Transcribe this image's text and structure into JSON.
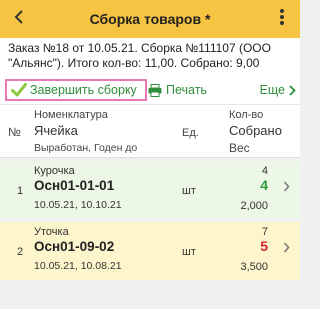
{
  "header": {
    "title": "Сборка товаров *",
    "back_icon": "chevron-left-icon",
    "menu_icon": "more-vertical-icon",
    "bg_color": "#f7c343"
  },
  "order": {
    "line1": "Заказ №18 от 10.05.21. Сборка №111107 (ООО",
    "line2": "\"Альянс\"). Итого кол-во: 11,00. Собрано: 9,00"
  },
  "toolbar": {
    "finish_label": "Завершить сборку",
    "print_label": "Печать",
    "more_label": "Еще",
    "accent_color": "#2f8e3b",
    "highlight_color": "#e978b4"
  },
  "table": {
    "headers": {
      "no": "№",
      "nomenclature": "Номенклатура",
      "cell": "Ячейка",
      "produced": "Выработан, Годен до",
      "unit": "Ед.",
      "qty": "Кол-во",
      "collected": "Собрано",
      "weight": "Вес"
    },
    "rows": [
      {
        "no": "1",
        "name": "Курочка",
        "cell": "Осн01-01-01",
        "produced": "10.05.21, 10.10.21",
        "unit": "шт",
        "qty": "4",
        "collected": "4",
        "collected_color": "#2e9a3a",
        "weight": "2,000",
        "bg_color": "#ecf7e6"
      },
      {
        "no": "2",
        "name": "Уточка",
        "cell": "Осн01-09-02",
        "produced": "10.05.21, 10.08.21",
        "unit": "шт",
        "qty": "7",
        "collected": "5",
        "collected_color": "#d8242a",
        "weight": "3,500",
        "bg_color": "#fdf5cc"
      }
    ]
  }
}
